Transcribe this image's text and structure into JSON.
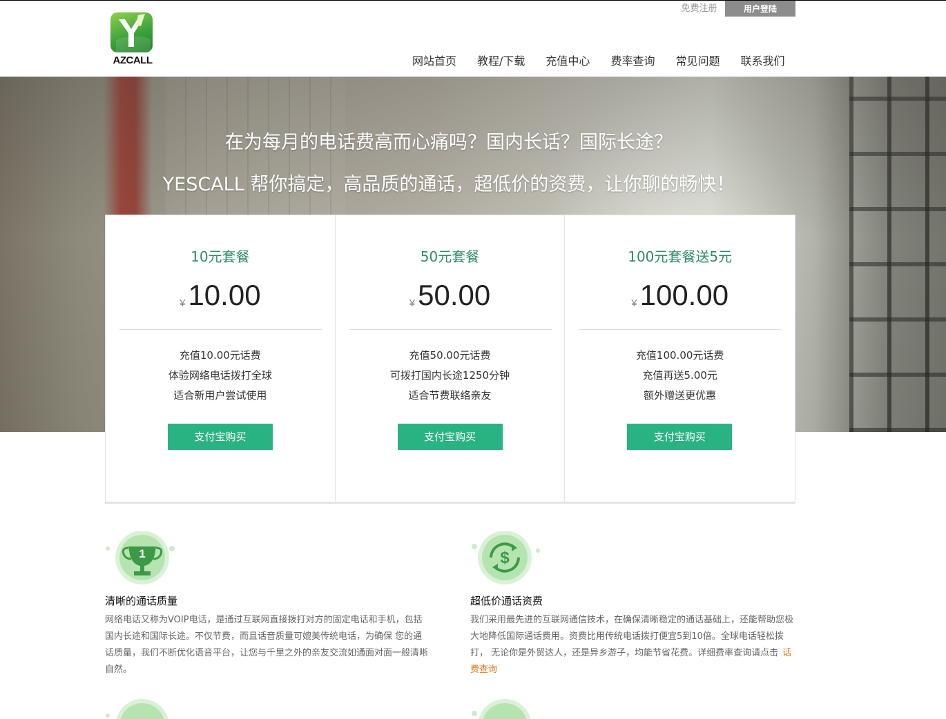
{
  "header": {
    "logo_text": "AZCALL",
    "register": "免费注册",
    "login": "用户登陆",
    "nav": [
      "网站首页",
      "教程/下载",
      "充值中心",
      "费率查询",
      "常见问题",
      "联系我们"
    ]
  },
  "banner": {
    "line1": "在为每月的电话费高而心痛吗？国内长话？国际长途？",
    "line2": "YESCALL 帮你搞定，高品质的通话，超低价的资费，让你聊的畅快！"
  },
  "packages": [
    {
      "title": "10元套餐",
      "currency": "¥",
      "price": "10.00",
      "desc": [
        "充值10.00元话费",
        "体验网络电话拨打全球",
        "适合新用户尝试使用"
      ],
      "button": "支付宝购买"
    },
    {
      "title": "50元套餐",
      "currency": "¥",
      "price": "50.00",
      "desc": [
        "充值50.00元话费",
        "可拨打国内长途1250分钟",
        "适合节费联络亲友"
      ],
      "button": "支付宝购买"
    },
    {
      "title": "100元套餐送5元",
      "currency": "¥",
      "price": "100.00",
      "desc": [
        "充值100.00元话费",
        "充值再送5.00元",
        "额外赠送更优惠"
      ],
      "button": "支付宝购买"
    }
  ],
  "features": [
    {
      "icon": "trophy-icon",
      "title": "清晰的通话质量",
      "text": "网络电话又称为VOIP电话，是通过互联网直接拨打对方的固定电话和手机，包括国内长途和国际长途。不仅节费，而且话音质量可媲美传统电话，为确保 您的通话质量，我们不断优化语音平台，让您与千里之外的亲友交流如通面对面一般清晰自然。"
    },
    {
      "icon": "dollar-exchange-icon",
      "title": "超低价通话资费",
      "text": "我们采用最先进的互联网通信技术，在确保清晰稳定的通话基础上，还能帮助您极大地降低国际通话费用。资费比用传统电话拨打便宜5到10倍。全球电话轻松拨打， 无论你是外贸达人，还是异乡游子，均能节省花费。详细费率查询请点击",
      "link": "话费查询"
    }
  ],
  "colors": {
    "accent": "#29b382",
    "title_green": "#2e8b66",
    "link_orange": "#e07a1f"
  }
}
